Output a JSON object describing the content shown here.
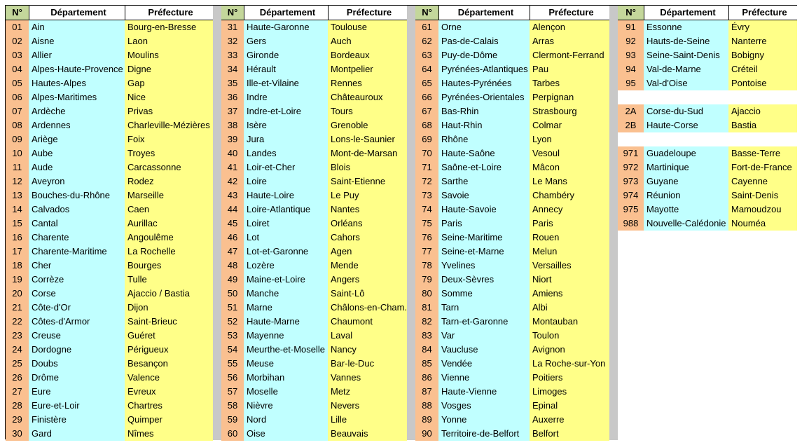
{
  "headers": {
    "num": "N°",
    "dept": "Département",
    "pref": "Préfecture"
  },
  "colors": {
    "header_num": "#c4d79b",
    "num": "#fac090",
    "dept": "#c0ffff",
    "pref": "#ffff88",
    "separator": "#c8c8c8"
  },
  "tables": [
    {
      "rows": [
        [
          "01",
          "Ain",
          "Bourg-en-Bresse"
        ],
        [
          "02",
          "Aisne",
          "Laon"
        ],
        [
          "03",
          "Allier",
          "Moulins"
        ],
        [
          "04",
          "Alpes-Haute-Provence",
          "Digne"
        ],
        [
          "05",
          "Hautes-Alpes",
          "Gap"
        ],
        [
          "06",
          "Alpes-Maritimes",
          "Nice"
        ],
        [
          "07",
          "Ardèche",
          "Privas"
        ],
        [
          "08",
          "Ardennes",
          "Charleville-Mézières"
        ],
        [
          "09",
          "Ariège",
          "Foix"
        ],
        [
          "10",
          "Aube",
          "Troyes"
        ],
        [
          "11",
          "Aude",
          "Carcassonne"
        ],
        [
          "12",
          "Aveyron",
          "Rodez"
        ],
        [
          "13",
          "Bouches-du-Rhône",
          "Marseille"
        ],
        [
          "14",
          "Calvados",
          "Caen"
        ],
        [
          "15",
          "Cantal",
          "Aurillac"
        ],
        [
          "16",
          "Charente",
          "Angoulême"
        ],
        [
          "17",
          "Charente-Maritime",
          "La Rochelle"
        ],
        [
          "18",
          "Cher",
          "Bourges"
        ],
        [
          "19",
          "Corrèze",
          "Tulle"
        ],
        [
          "20",
          "Corse",
          "Ajaccio / Bastia"
        ],
        [
          "21",
          "Côte-d'Or",
          "Dijon"
        ],
        [
          "22",
          "Côtes-d'Armor",
          "Saint-Brieuc"
        ],
        [
          "23",
          "Creuse",
          "Guéret"
        ],
        [
          "24",
          "Dordogne",
          "Périgueux"
        ],
        [
          "25",
          "Doubs",
          "Besançon"
        ],
        [
          "26",
          "Drôme",
          "Valence"
        ],
        [
          "27",
          "Eure",
          "Evreux"
        ],
        [
          "28",
          "Eure-et-Loir",
          "Chartres"
        ],
        [
          "29",
          "Finistère",
          "Quimper"
        ],
        [
          "30",
          "Gard",
          "Nîmes"
        ]
      ]
    },
    {
      "rows": [
        [
          "31",
          "Haute-Garonne",
          "Toulouse"
        ],
        [
          "32",
          "Gers",
          "Auch"
        ],
        [
          "33",
          "Gironde",
          "Bordeaux"
        ],
        [
          "34",
          "Hérault",
          "Montpelier"
        ],
        [
          "35",
          "Ille-et-Vilaine",
          "Rennes"
        ],
        [
          "36",
          "Indre",
          "Châteauroux"
        ],
        [
          "37",
          "Indre-et-Loire",
          "Tours"
        ],
        [
          "38",
          "Isère",
          "Grenoble"
        ],
        [
          "39",
          "Jura",
          "Lons-le-Saunier"
        ],
        [
          "40",
          "Landes",
          "Mont-de-Marsan"
        ],
        [
          "41",
          "Loir-et-Cher",
          "Blois"
        ],
        [
          "42",
          "Loire",
          "Saint-Etienne"
        ],
        [
          "43",
          "Haute-Loire",
          "Le Puy"
        ],
        [
          "44",
          "Loire-Atlantique",
          "Nantes"
        ],
        [
          "45",
          "Loiret",
          "Orléans"
        ],
        [
          "46",
          "Lot",
          "Cahors"
        ],
        [
          "47",
          "Lot-et-Garonne",
          "Agen"
        ],
        [
          "48",
          "Lozère",
          "Mende"
        ],
        [
          "49",
          "Maine-et-Loire",
          "Angers"
        ],
        [
          "50",
          "Manche",
          "Saint-Lô"
        ],
        [
          "51",
          "Marne",
          "Châlons-en-Cham."
        ],
        [
          "52",
          "Haute-Marne",
          "Chaumont"
        ],
        [
          "53",
          "Mayenne",
          "Laval"
        ],
        [
          "54",
          "Meurthe-et-Moselle",
          "Nancy"
        ],
        [
          "55",
          "Meuse",
          "Bar-le-Duc"
        ],
        [
          "56",
          "Morbihan",
          "Vannes"
        ],
        [
          "57",
          "Moselle",
          "Metz"
        ],
        [
          "58",
          "Nièvre",
          "Nevers"
        ],
        [
          "59",
          "Nord",
          "Lille"
        ],
        [
          "60",
          "Oise",
          "Beauvais"
        ]
      ]
    },
    {
      "rows": [
        [
          "61",
          "Orne",
          "Alençon"
        ],
        [
          "62",
          "Pas-de-Calais",
          "Arras"
        ],
        [
          "63",
          "Puy-de-Dôme",
          "Clermont-Ferrand"
        ],
        [
          "64",
          "Pyrénées-Atlantiques",
          "Pau"
        ],
        [
          "65",
          "Hautes-Pyrénées",
          "Tarbes"
        ],
        [
          "66",
          "Pyrénées-Orientales",
          "Perpignan"
        ],
        [
          "67",
          "Bas-Rhin",
          "Strasbourg"
        ],
        [
          "68",
          "Haut-Rhin",
          "Colmar"
        ],
        [
          "69",
          "Rhône",
          "Lyon"
        ],
        [
          "70",
          "Haute-Saône",
          "Vesoul"
        ],
        [
          "71",
          "Saône-et-Loire",
          "Mâcon"
        ],
        [
          "72",
          "Sarthe",
          "Le Mans"
        ],
        [
          "73",
          "Savoie",
          "Chambéry"
        ],
        [
          "74",
          "Haute-Savoie",
          "Annecy"
        ],
        [
          "75",
          "Paris",
          "Paris"
        ],
        [
          "76",
          "Seine-Maritime",
          "Rouen"
        ],
        [
          "77",
          "Seine-et-Marne",
          "Melun"
        ],
        [
          "78",
          "Yvelines",
          "Versailles"
        ],
        [
          "79",
          "Deux-Sèvres",
          "Niort"
        ],
        [
          "80",
          "Somme",
          "Amiens"
        ],
        [
          "81",
          "Tarn",
          "Albi"
        ],
        [
          "82",
          "Tarn-et-Garonne",
          "Montauban"
        ],
        [
          "83",
          "Var",
          "Toulon"
        ],
        [
          "84",
          "Vaucluse",
          "Avignon"
        ],
        [
          "85",
          "Vendée",
          "La Roche-sur-Yon"
        ],
        [
          "86",
          "Vienne",
          "Poitiers"
        ],
        [
          "87",
          "Haute-Vienne",
          "Limoges"
        ],
        [
          "88",
          "Vosges",
          "Epinal"
        ],
        [
          "89",
          "Yonne",
          "Auxerre"
        ],
        [
          "90",
          "Territoire-de-Belfort",
          "Belfort"
        ]
      ]
    },
    {
      "rows": [
        [
          "91",
          "Essonne",
          "Évry"
        ],
        [
          "92",
          "Hauts-de-Seine",
          "Nanterre"
        ],
        [
          "93",
          "Seine-Saint-Denis",
          "Bobigny"
        ],
        [
          "94",
          "Val-de-Marne",
          "Créteil"
        ],
        [
          "95",
          "Val-d'Oise",
          "Pontoise"
        ],
        null,
        [
          "2A",
          "Corse-du-Sud",
          "Ajaccio"
        ],
        [
          "2B",
          "Haute-Corse",
          "Bastia"
        ],
        null,
        [
          "971",
          "Guadeloupe",
          "Basse-Terre"
        ],
        [
          "972",
          "Martinique",
          "Fort-de-France"
        ],
        [
          "973",
          "Guyane",
          "Cayenne"
        ],
        [
          "974",
          "Réunion",
          "Saint-Denis"
        ],
        [
          "975",
          "Mayotte",
          "Mamoudzou"
        ],
        [
          "988",
          "Nouvelle-Calédonie",
          "Nouméa"
        ]
      ]
    }
  ]
}
